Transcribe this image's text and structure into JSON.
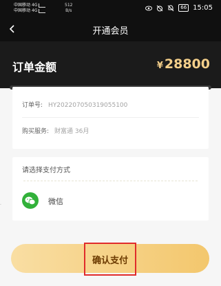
{
  "status_bar": {
    "carrier1": "中国移动",
    "carrier1_tag": "4G",
    "carrier2": "中国移动",
    "carrier2_tag": "4G",
    "speed_value": "512",
    "speed_unit": "B/s",
    "battery": "66",
    "time": "15:05",
    "icons": [
      "eye-icon",
      "alarm-off-icon",
      "mute-icon",
      "battery-icon"
    ]
  },
  "nav": {
    "title": "开通会员",
    "back_icon": "chevron-left-icon"
  },
  "amount": {
    "label": "订单金额",
    "currency": "¥",
    "value": "28800",
    "value_color": "#f4cf8a"
  },
  "order": {
    "number_label": "订单号:",
    "number_value": "HY202207050319055100",
    "service_label": "购买服务:",
    "service_value": "财富通 36月"
  },
  "payment": {
    "title": "请选择支付方式",
    "method_label": "微信",
    "method_icon": "wechat-icon",
    "brand_color": "#32b13a"
  },
  "confirm": {
    "label": "确认支付",
    "highlight_color": "#e02b2b"
  }
}
